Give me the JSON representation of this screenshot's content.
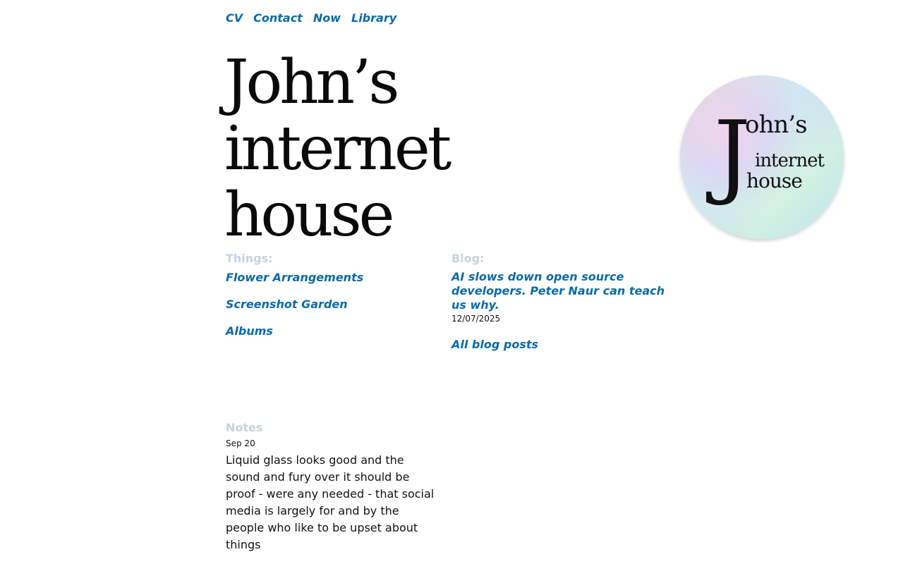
{
  "nav": {
    "items": [
      {
        "label": "CV"
      },
      {
        "label": "Contact"
      },
      {
        "label": "Now"
      },
      {
        "label": "Library"
      }
    ]
  },
  "header": {
    "title_line1": "John’s internet",
    "title_line2": "house"
  },
  "logo": {
    "text_line1": "John’s",
    "text_line2": "internet",
    "text_line3": "house",
    "icon": "holographic-circle-logo"
  },
  "things": {
    "heading": "Things:",
    "items": [
      {
        "label": "Flower Arrangements"
      },
      {
        "label": "Screenshot Garden"
      },
      {
        "label": "Albums"
      }
    ]
  },
  "blog": {
    "heading": "Blog:",
    "latest": {
      "title": "AI slows down open source developers. Peter Naur can teach us why.",
      "date": "12/07/2025"
    },
    "all_posts_label": "All blog posts"
  },
  "notes": {
    "heading": "Notes",
    "items": [
      {
        "date": "Sep 20",
        "body": "Liquid glass looks good and the sound and fury over it should be proof - were any needed - that social media is largely for and by the people who like to be upset about things"
      }
    ]
  },
  "colors": {
    "link": "#0b6aa8",
    "section_label": "#c7d2e0",
    "text": "#111111"
  }
}
